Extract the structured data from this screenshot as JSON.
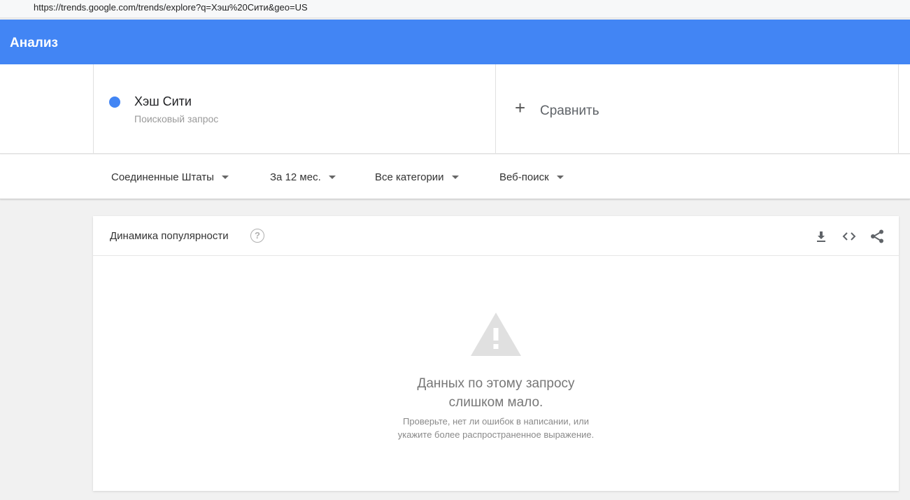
{
  "browser": {
    "url": "https://trends.google.com/trends/explore?q=Хэш%20Сити&geo=US"
  },
  "header": {
    "title": "Анализ",
    "accent_color": "#4285f4"
  },
  "search_term": {
    "name": "Хэш Сити",
    "type": "Поисковый запрос",
    "dot_color": "#4285f4"
  },
  "compare": {
    "plus": "+",
    "label": "Сравнить"
  },
  "filters": {
    "region": "Соединенные Штаты",
    "period": "За 12 мес.",
    "category": "Все категории",
    "search_type": "Веб-поиск"
  },
  "interest_card": {
    "title": "Динамика популярности",
    "help": "?",
    "actions": [
      "download-icon",
      "embed-icon",
      "share-icon"
    ],
    "empty_title_line1": "Данных по этому запросу",
    "empty_title_line2": "слишком мало.",
    "empty_hint_line1": "Проверьте, нет ли ошибок в написании, или",
    "empty_hint_line2": "укажите более распространенное выражение."
  }
}
